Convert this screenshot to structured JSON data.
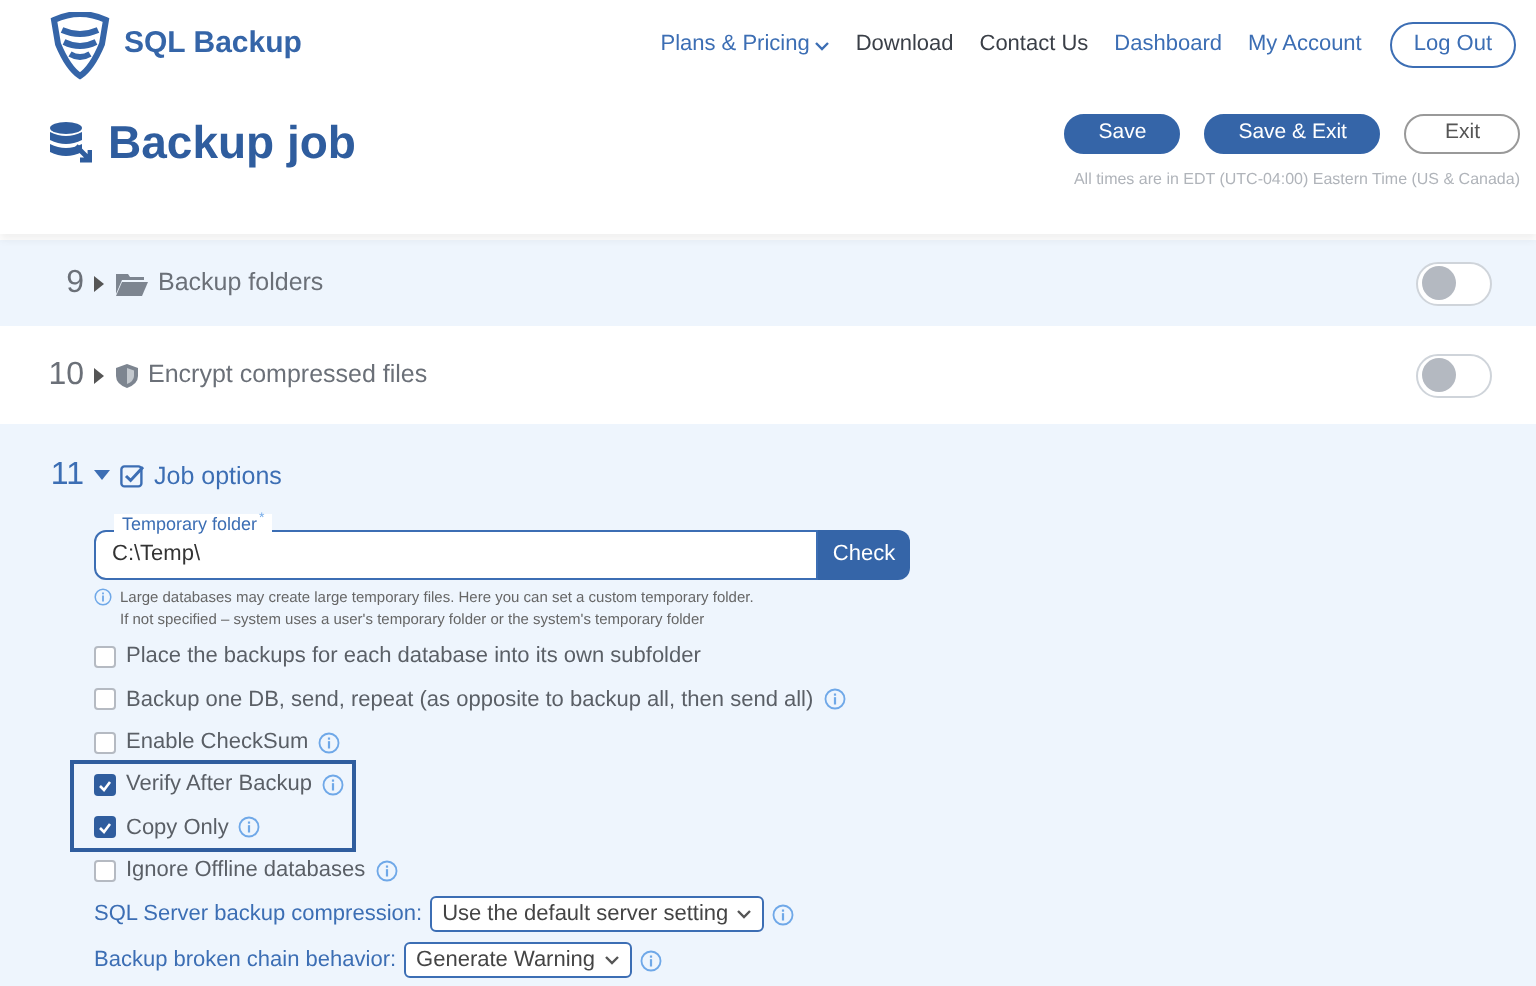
{
  "brand": "SQL Backup",
  "nav": [
    {
      "label": "Plans & Pricing",
      "dropdown": true,
      "color": "#3c6eb4"
    },
    {
      "label": "Download",
      "dropdown": false,
      "color": "#3a3f47"
    },
    {
      "label": "Contact Us",
      "dropdown": false,
      "color": "#3a3f47"
    },
    {
      "label": "Dashboard",
      "dropdown": false,
      "color": "#3c6eb4"
    },
    {
      "label": "My Account",
      "dropdown": false,
      "color": "#3c6eb4"
    }
  ],
  "logout": "Log Out",
  "page_title": "Backup job",
  "actions": [
    {
      "label": "Save",
      "kind": "primary"
    },
    {
      "label": "Save & Exit",
      "kind": "primary"
    },
    {
      "label": "Exit",
      "kind": "outline"
    }
  ],
  "timezone_note": "All times are in EDT (UTC-04:00) Eastern Time (US & Canada)",
  "sections": [
    {
      "number": "9",
      "title": "Backup folders",
      "expanded": false,
      "toggle": {
        "on": false
      }
    },
    {
      "number": "10",
      "title": "Encrypt compressed files",
      "expanded": false,
      "toggle": {
        "on": false
      }
    },
    {
      "number": "11",
      "title": "Job options",
      "expanded": true
    }
  ],
  "job_options": {
    "temp_folder": {
      "label": "Temporary folder",
      "required_mark": "*",
      "value": "C:\\Temp\\",
      "button": "Check"
    },
    "hint_lines": [
      "Large databases may create large temporary files. Here you can set a custom temporary folder.",
      "If not specified – system uses a user's temporary folder or the system's temporary folder"
    ],
    "options": [
      {
        "label": "Place the backups for each database into its own subfolder",
        "checked": false,
        "info": false,
        "highlighted": false
      },
      {
        "label": "Backup one DB, send, repeat (as opposite to backup all, then send all)",
        "checked": false,
        "info": true,
        "highlighted": false
      },
      {
        "label": "Enable CheckSum",
        "checked": false,
        "info": true,
        "highlighted": false
      },
      {
        "label": "Verify After Backup",
        "checked": true,
        "info": true,
        "highlighted": true
      },
      {
        "label": "Copy Only",
        "checked": true,
        "info": true,
        "highlighted": true
      },
      {
        "label": "Ignore Offline databases",
        "checked": false,
        "info": true,
        "highlighted": false
      }
    ],
    "selects": [
      {
        "label": "SQL Server backup compression:",
        "value": "Use the default server setting"
      },
      {
        "label": "Backup broken chain behavior:",
        "value": "Generate Warning"
      }
    ]
  }
}
